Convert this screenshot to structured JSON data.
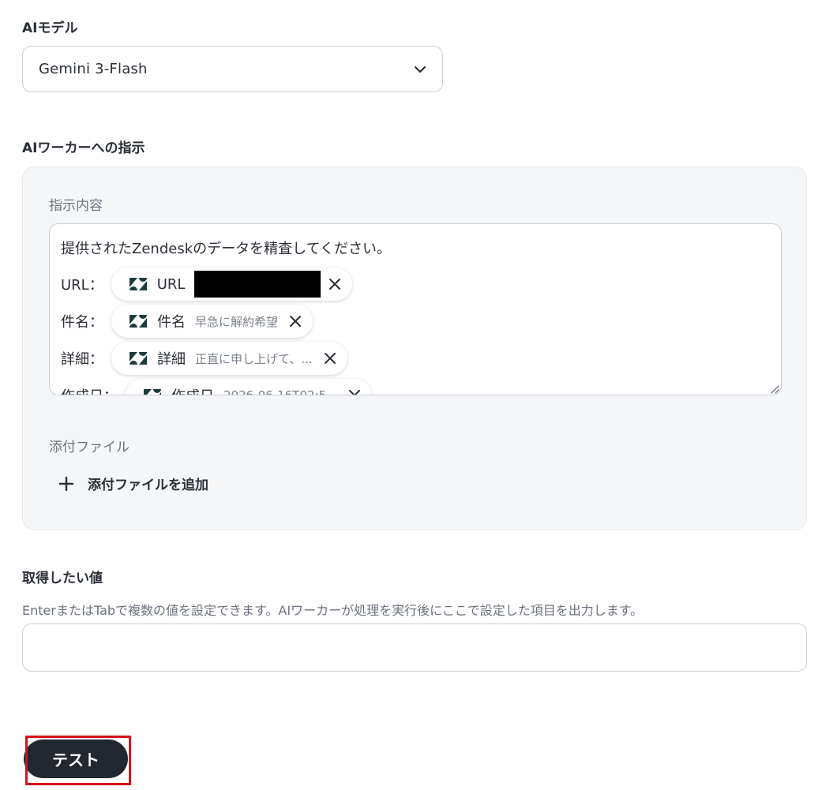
{
  "ai_model": {
    "label": "AIモデル",
    "selected": "Gemini 3-Flash"
  },
  "instruction": {
    "label": "AIワーカーへの指示",
    "content_label": "指示内容",
    "first_line": "提供されたZendeskのデータを精査してください。",
    "rows": [
      {
        "label": "URL：",
        "chip_name": "URL",
        "chip_value": ""
      },
      {
        "label": "件名：",
        "chip_name": "件名",
        "chip_value": "早急に解約希望"
      },
      {
        "label": "詳細：",
        "chip_name": "詳細",
        "chip_value": "正直に申し上げて、..."
      },
      {
        "label": "作成日：",
        "chip_name": "作成日",
        "chip_value": "2026-06-16T02:5..."
      }
    ],
    "attach_label": "添付ファイル",
    "add_attach_label": "添付ファイルを追加"
  },
  "output": {
    "label": "取得したい値",
    "description": "EnterまたはTabで複数の値を設定できます。AIワーカーが処理を実行後にここで設定した項目を出力します。",
    "input_value": ""
  },
  "test_button_label": "テスト",
  "icons": {
    "select_chevron": "chevron-down-icon",
    "chip_source": "zendesk-icon",
    "chip_remove": "close-icon",
    "add": "plus-icon",
    "resize": "resize-grip-icon"
  },
  "colors": {
    "test_button_bg": "#222730",
    "highlight": "#d6101b",
    "zendesk_icon": "#1f3a3d"
  }
}
